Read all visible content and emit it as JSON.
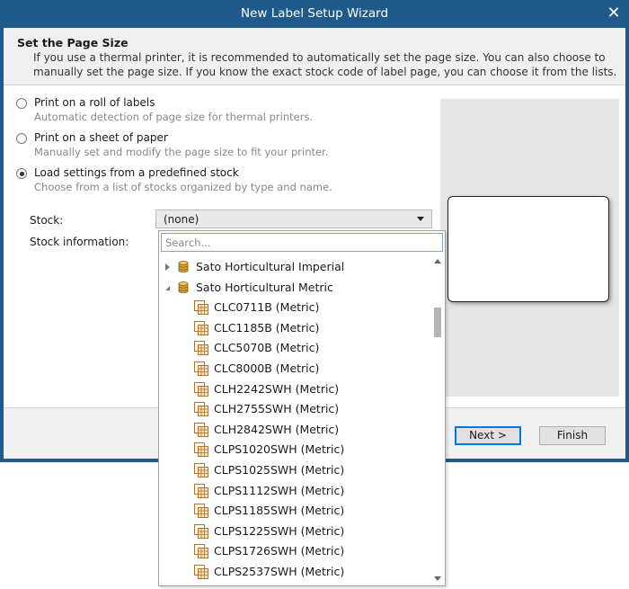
{
  "window": {
    "title": "New Label Setup Wizard",
    "close_glyph": "✕"
  },
  "header": {
    "title": "Set the Page Size",
    "description": "If you use a thermal printer, it is recommended to automatically set the page size. You can also choose to manually set the page size. If you know the exact stock code of label page, you can choose it from the lists."
  },
  "options": [
    {
      "label": "Print on a roll of labels",
      "sub": "Automatic detection of page size for thermal printers.",
      "selected": false
    },
    {
      "label": "Print on a sheet of paper",
      "sub": "Manually set and modify the page size to fit your printer.",
      "selected": false
    },
    {
      "label": "Load settings from a predefined stock",
      "sub": "Choose from a list of stocks organized by type and name.",
      "selected": true
    }
  ],
  "stock": {
    "label": "Stock:",
    "value": "(none)"
  },
  "stock_info": {
    "label": "Stock information:"
  },
  "search": {
    "placeholder": "Search..."
  },
  "tree": [
    {
      "text": "Sato Horticultural Imperial",
      "level": 0,
      "expander": "closed",
      "icon": "database-icon"
    },
    {
      "text": "Sato Horticultural Metric",
      "level": 0,
      "expander": "open",
      "icon": "database-icon"
    },
    {
      "text": "CLC0711B (Metric)",
      "level": 1,
      "icon": "stock-grid-icon"
    },
    {
      "text": "CLC1185B (Metric)",
      "level": 1,
      "icon": "stock-grid-icon"
    },
    {
      "text": "CLC5070B (Metric)",
      "level": 1,
      "icon": "stock-grid-icon"
    },
    {
      "text": "CLC8000B (Metric)",
      "level": 1,
      "icon": "stock-grid-icon"
    },
    {
      "text": "CLH2242SWH (Metric)",
      "level": 1,
      "icon": "stock-grid-icon"
    },
    {
      "text": "CLH2755SWH (Metric)",
      "level": 1,
      "icon": "stock-grid-icon"
    },
    {
      "text": "CLH2842SWH (Metric)",
      "level": 1,
      "icon": "stock-grid-icon"
    },
    {
      "text": "CLPS1020SWH (Metric)",
      "level": 1,
      "icon": "stock-grid-icon"
    },
    {
      "text": "CLPS1025SWH (Metric)",
      "level": 1,
      "icon": "stock-grid-icon"
    },
    {
      "text": "CLPS1112SWH (Metric)",
      "level": 1,
      "icon": "stock-grid-icon"
    },
    {
      "text": "CLPS1185SWH (Metric)",
      "level": 1,
      "icon": "stock-grid-icon"
    },
    {
      "text": "CLPS1225SWH (Metric)",
      "level": 1,
      "icon": "stock-grid-icon"
    },
    {
      "text": "CLPS1726SWH (Metric)",
      "level": 1,
      "icon": "stock-grid-icon"
    },
    {
      "text": "CLPS2537SWH (Metric)",
      "level": 1,
      "icon": "stock-grid-icon"
    }
  ],
  "footer": {
    "next_label": "Next >",
    "finish_label": "Finish"
  },
  "colors": {
    "titlebar": "#1f5a8b",
    "accent": "#0078d7",
    "db_icon": "#d9a33a",
    "grid_icon": "#b5702a"
  }
}
